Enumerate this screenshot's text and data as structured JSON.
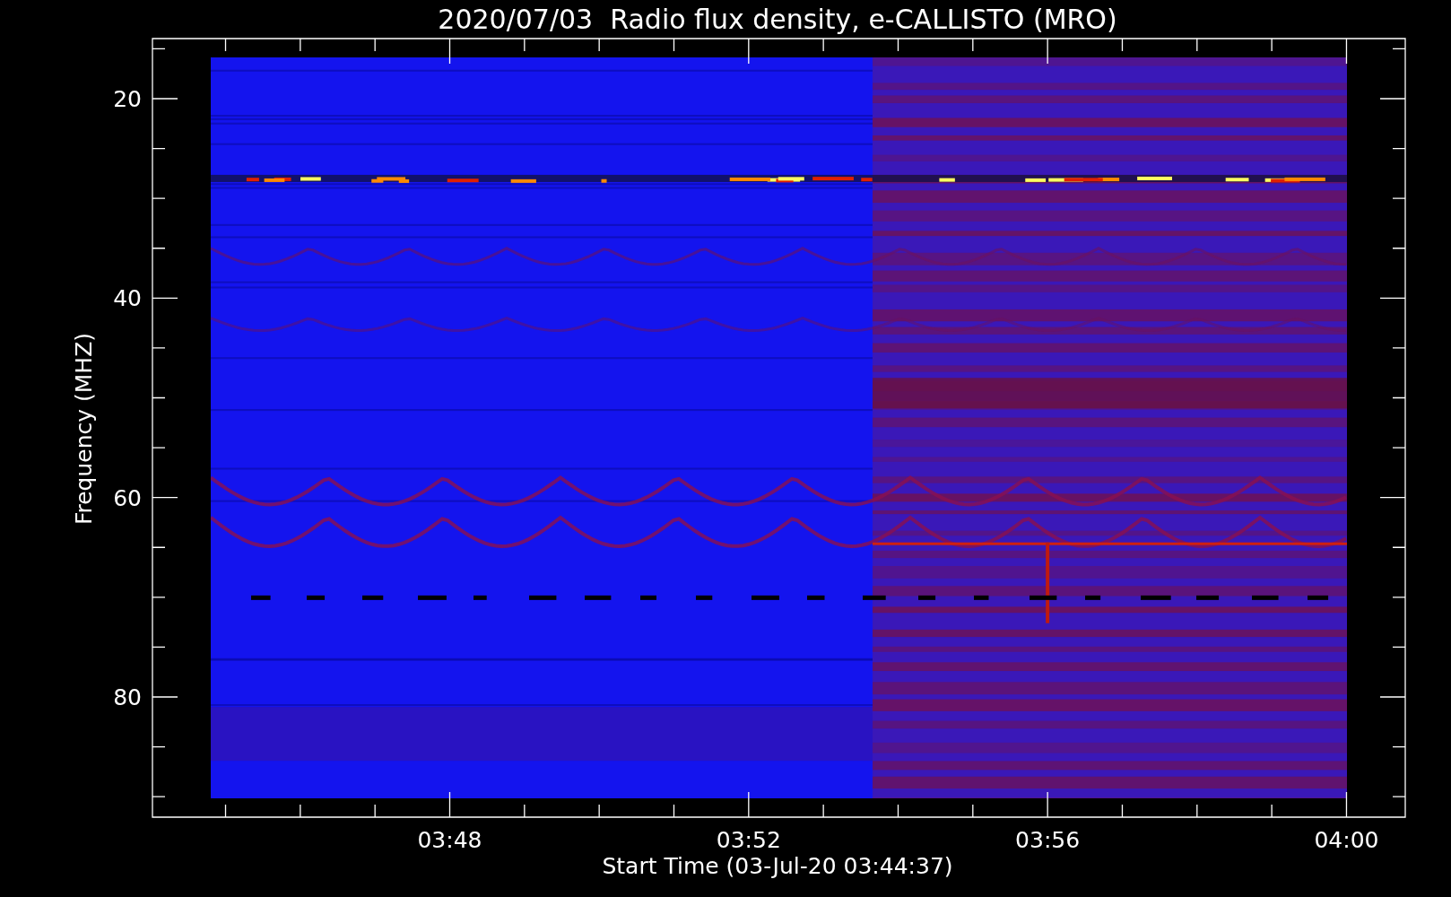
{
  "title": "2020/07/03  Radio flux density, e-CALLISTO (MRO)",
  "y_axis": {
    "label": "Frequency (MHZ)",
    "ticks": [
      "20",
      "40",
      "60",
      "80"
    ]
  },
  "x_axis": {
    "label": "Start Time (03-Jul-20 03:44:37)",
    "ticks": [
      "03:48",
      "03:52",
      "03:56",
      "04:00"
    ]
  }
}
